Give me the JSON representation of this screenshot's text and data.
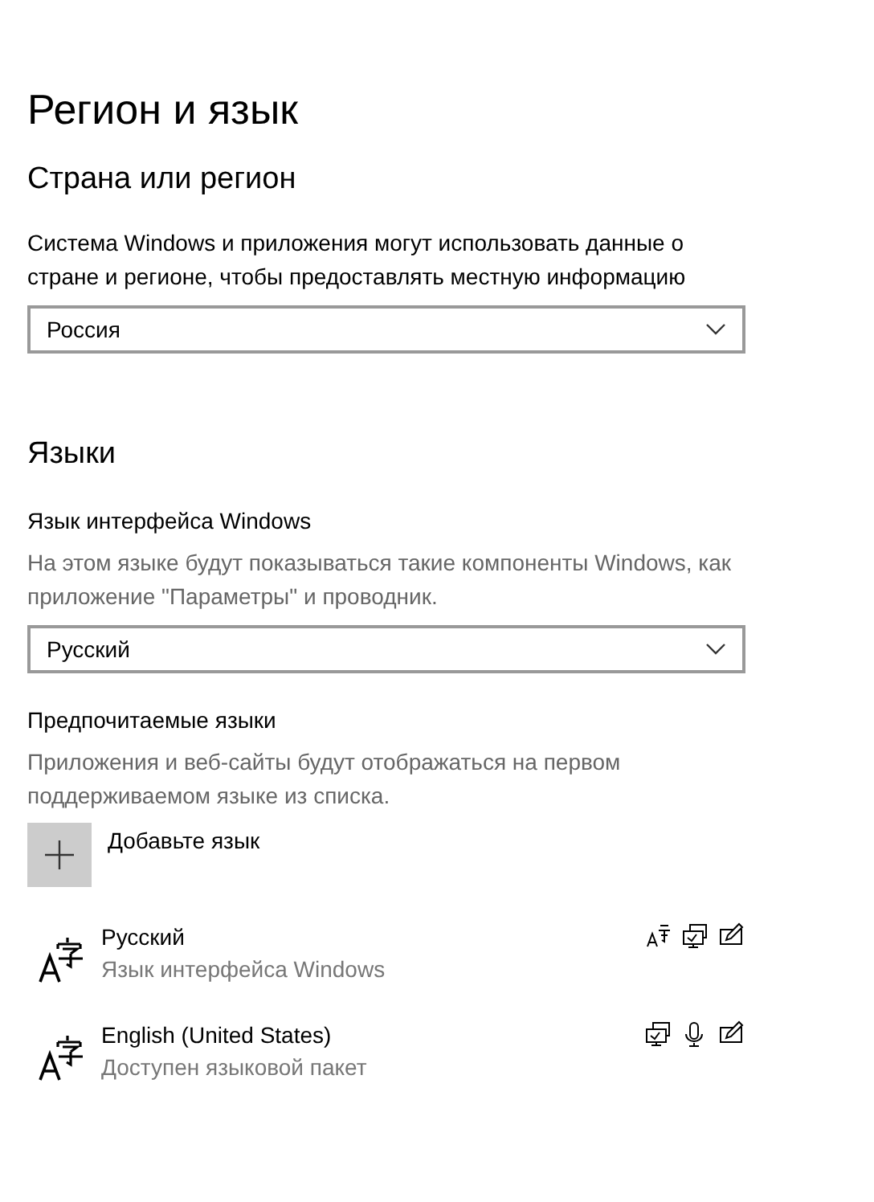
{
  "title": "Регион и язык",
  "region": {
    "heading": "Страна или регион",
    "description": "Система Windows и приложения могут использовать данные о стране и регионе, чтобы предоставлять местную информацию",
    "dropdown": "Россия"
  },
  "languages": {
    "heading": "Языки",
    "display_language": {
      "label": "Язык интерфейса Windows",
      "description": "На этом языке будут показываться такие компоненты Windows, как приложение \"Параметры\" и проводник.",
      "dropdown": "Русский"
    },
    "preferred": {
      "label": "Предпочитаемые языки",
      "description": "Приложения и веб-сайты будут отображаться на первом поддерживаемом языке из списка.",
      "add_button": "Добавьте язык",
      "items": [
        {
          "name": "Русский",
          "status": "Язык интерфейса Windows",
          "features": [
            {
              "kind": "language-pack"
            },
            {
              "kind": "display"
            },
            {
              "kind": "handwriting"
            }
          ]
        },
        {
          "name": "English (United States)",
          "status": "Доступен языковой пакет",
          "features": [
            {
              "kind": "display"
            },
            {
              "kind": "speech"
            },
            {
              "kind": "handwriting"
            }
          ]
        }
      ]
    }
  }
}
